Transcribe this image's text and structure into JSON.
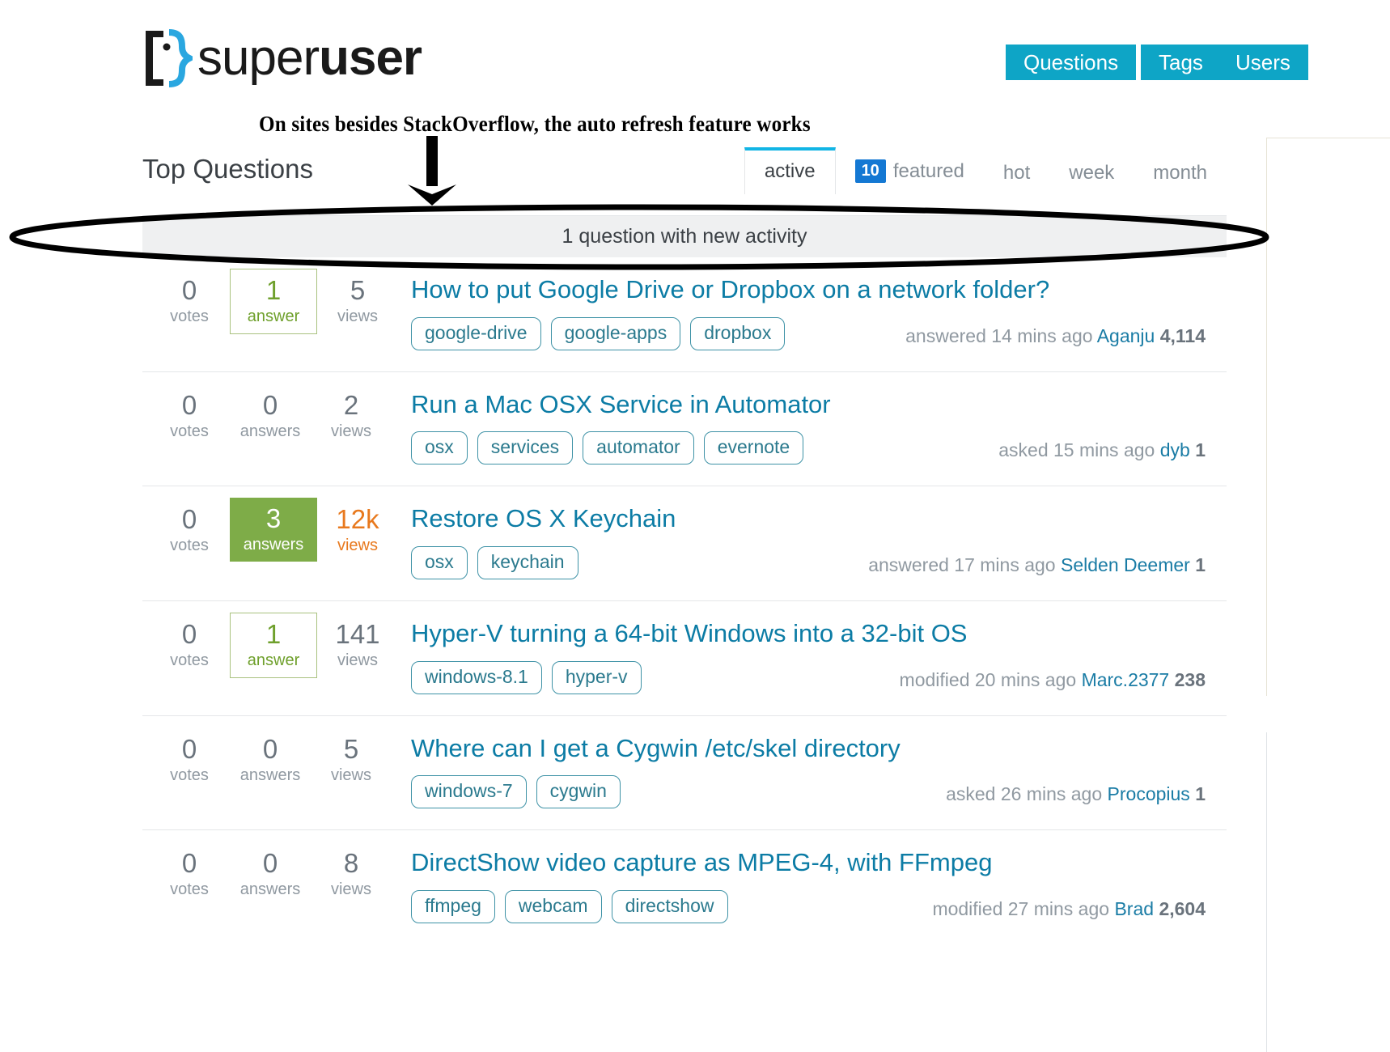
{
  "site": {
    "logo_light": "super",
    "logo_bold": "user",
    "logo_icon": "superuser-bracket-face-icon"
  },
  "nav": [
    {
      "label": "Questions",
      "name": "nav-questions"
    },
    {
      "label": "Tags",
      "name": "nav-tags"
    },
    {
      "label": "Users",
      "name": "nav-users"
    }
  ],
  "annotation": {
    "text": "On sites besides StackOverflow, the auto refresh feature works",
    "arrow": "down-arrow-annotation",
    "ellipse": "ellipse-highlight-annotation"
  },
  "main": {
    "heading": "Top Questions",
    "new_activity_text": "1 question with new activity"
  },
  "tabs": [
    {
      "label": "active",
      "selected": true,
      "badge": ""
    },
    {
      "label": "featured",
      "selected": false,
      "badge": "10"
    },
    {
      "label": "hot",
      "selected": false,
      "badge": ""
    },
    {
      "label": "week",
      "selected": false,
      "badge": ""
    },
    {
      "label": "month",
      "selected": false,
      "badge": ""
    }
  ],
  "questions": [
    {
      "votes": "0",
      "votes_label": "votes",
      "answers": "1",
      "answers_label": "answer",
      "answers_style": "outline",
      "views": "5",
      "views_label": "views",
      "views_style": "normal",
      "title": "How to put Google Drive or Dropbox on a network folder?",
      "tags": [
        "google-drive",
        "google-apps",
        "dropbox"
      ],
      "meta_action": "answered 14 mins ago",
      "meta_user": "Aganju",
      "meta_rep": "4,114"
    },
    {
      "votes": "0",
      "votes_label": "votes",
      "answers": "0",
      "answers_label": "answers",
      "answers_style": "none",
      "views": "2",
      "views_label": "views",
      "views_style": "normal",
      "title": "Run a Mac OSX Service in Automator",
      "tags": [
        "osx",
        "services",
        "automator",
        "evernote"
      ],
      "meta_action": "asked 15 mins ago",
      "meta_user": "dyb",
      "meta_rep": "1"
    },
    {
      "votes": "0",
      "votes_label": "votes",
      "answers": "3",
      "answers_label": "answers",
      "answers_style": "filled",
      "views": "12k",
      "views_label": "views",
      "views_style": "hot",
      "title": "Restore OS X Keychain",
      "tags": [
        "osx",
        "keychain"
      ],
      "meta_action": "answered 17 mins ago",
      "meta_user": "Selden Deemer",
      "meta_rep": "1"
    },
    {
      "votes": "0",
      "votes_label": "votes",
      "answers": "1",
      "answers_label": "answer",
      "answers_style": "outline",
      "views": "141",
      "views_label": "views",
      "views_style": "normal",
      "title": "Hyper-V turning a 64-bit Windows into a 32-bit OS",
      "tags": [
        "windows-8.1",
        "hyper-v"
      ],
      "meta_action": "modified 20 mins ago",
      "meta_user": "Marc.2377",
      "meta_rep": "238"
    },
    {
      "votes": "0",
      "votes_label": "votes",
      "answers": "0",
      "answers_label": "answers",
      "answers_style": "none",
      "views": "5",
      "views_label": "views",
      "views_style": "normal",
      "title": "Where can I get a Cygwin /etc/skel directory",
      "tags": [
        "windows-7",
        "cygwin"
      ],
      "meta_action": "asked 26 mins ago",
      "meta_user": "Procopius",
      "meta_rep": "1"
    },
    {
      "votes": "0",
      "votes_label": "votes",
      "answers": "0",
      "answers_label": "answers",
      "answers_style": "none",
      "views": "8",
      "views_label": "views",
      "views_style": "normal",
      "title": "DirectShow video capture as MPEG-4, with FFmpeg",
      "tags": [
        "ffmpeg",
        "webcam",
        "directshow"
      ],
      "meta_action": "modified 27 mins ago",
      "meta_user": "Brad",
      "meta_rep": "2,604"
    }
  ],
  "colors": {
    "nav_blue": "#0ea5c6",
    "link_teal": "#0c7ca5",
    "tag_teal": "#2b7a8e",
    "answer_green": "#7eac48",
    "views_orange": "#e8791e",
    "badge_blue": "#1478d3",
    "active_tab_top": "#12b5e5",
    "muted_gray": "#9099a1"
  }
}
